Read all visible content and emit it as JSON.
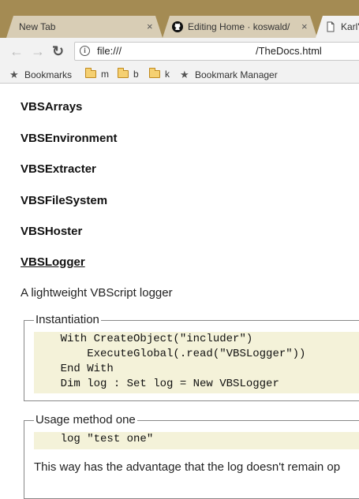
{
  "tabs": [
    {
      "label": "New Tab",
      "close": "×"
    },
    {
      "label": "Editing Home · koswald/",
      "close": "×"
    },
    {
      "label": "Karl'"
    }
  ],
  "toolbar": {
    "back": "←",
    "forward": "→",
    "reload": "↻",
    "url_scheme": "file:///",
    "url_path": "/TheDocs.html"
  },
  "bookmarks": [
    {
      "label": "Bookmarks",
      "icon": "star-icon"
    },
    {
      "label": "m",
      "icon": "folder-icon"
    },
    {
      "label": "b",
      "icon": "folder-icon"
    },
    {
      "label": "k",
      "icon": "folder-icon"
    },
    {
      "label": "Bookmark Manager",
      "icon": "star-icon"
    }
  ],
  "page": {
    "headings": [
      "VBSArrays",
      "VBSEnvironment",
      "VBSExtracter",
      "VBSFileSystem",
      "VBSHoster",
      "VBSLogger"
    ],
    "description": "A lightweight VBScript logger",
    "sections": [
      {
        "legend": "Instantiation",
        "code": [
          "    With CreateObject(\"includer\")",
          "        ExecuteGlobal(.read(\"VBSLogger\"))",
          "    End With",
          "    Dim log : Set log = New VBSLogger"
        ]
      },
      {
        "legend": "Usage method one",
        "code": [
          "    log \"test one\""
        ],
        "paragraph": "This way has the advantage that the log doesn't remain op"
      }
    ]
  },
  "colors": {
    "frame": "#a48b53",
    "toolbar": "#f2f2f2",
    "code_bg": "#f4f2d9"
  }
}
